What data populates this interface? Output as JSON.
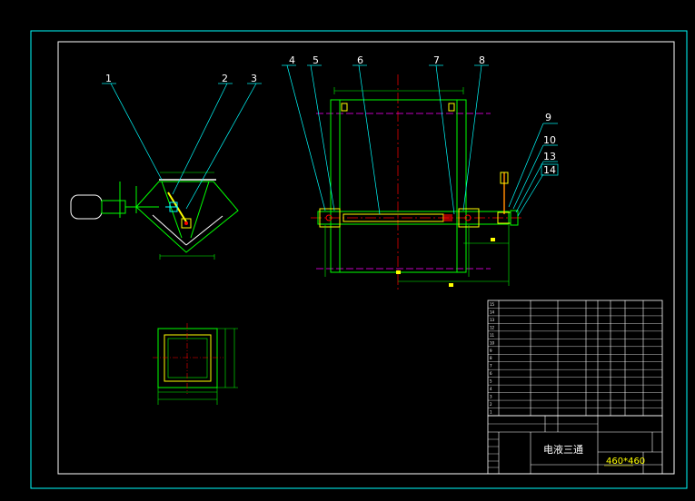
{
  "callouts": {
    "left_view": [
      "1",
      "2",
      "3"
    ],
    "right_view": [
      "4",
      "5",
      "6",
      "7",
      "8"
    ],
    "right_side": [
      "9",
      "10",
      "13",
      "14"
    ]
  },
  "title_block": {
    "drawing_name": "电液三通",
    "size_label": "460*460"
  },
  "bom_row_numbers": [
    "15",
    "14",
    "13",
    "12",
    "11",
    "10",
    "9",
    "8",
    "7",
    "6",
    "5",
    "4",
    "3",
    "2",
    "1"
  ],
  "colors": {
    "background": "#000000",
    "frame": "#00ffff",
    "border": "#ffffff",
    "body": "#00ff00",
    "accent": "#ffff00",
    "centerline": "#ff0000",
    "hidden": "#ff00ff"
  }
}
